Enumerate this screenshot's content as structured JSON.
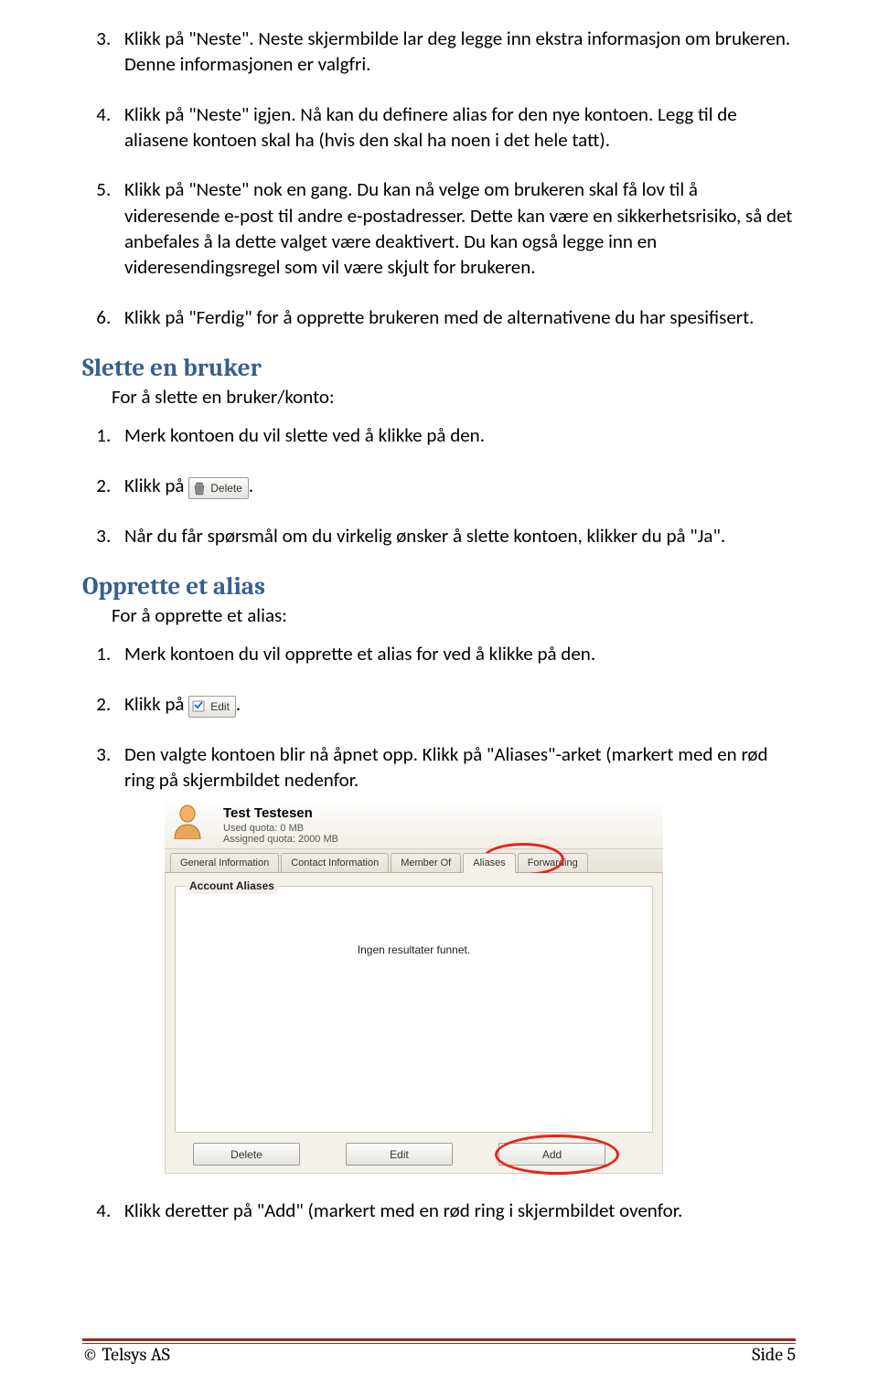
{
  "steps_continue_a": [
    "Klikk på \"Neste\". Neste skjermbilde lar deg legge inn ekstra informasjon om brukeren. Denne informasjonen er valgfri.",
    "Klikk på \"Neste\" igjen. Nå kan du definere alias for den nye kontoen. Legg til de aliasene kontoen skal ha (hvis den skal ha noen i det hele tatt).",
    "Klikk på \"Neste\" nok en gang. Du kan nå velge om brukeren skal få lov til å videresende e-post til andre e-postadresser. Dette kan være en sikkerhetsrisiko, så det anbefales å la dette valget være deaktivert. Du kan også legge inn en videresendingsregel som vil være skjult for brukeren.",
    "Klikk på \"Ferdig\" for å opprette brukeren med de alternativene du har spesifisert."
  ],
  "section_delete": {
    "heading": "Slette en bruker",
    "lead": "For å slette en bruker/konto:",
    "items": {
      "i1": "Merk kontoen du vil slette ved å klikke på den.",
      "i2_pre": "Klikk på ",
      "i2_btn_label": "Delete",
      "i2_post": ".",
      "i3": "Når du får spørsmål om du virkelig ønsker å slette kontoen, klikker du på \"Ja\"."
    }
  },
  "section_alias": {
    "heading": "Opprette et alias",
    "lead": "For å opprette et alias:",
    "items": {
      "i1": "Merk kontoen du vil opprette et alias for ved å klikke på den.",
      "i2_pre": "Klikk på ",
      "i2_btn_label": "Edit",
      "i2_post": ".",
      "i3": "Den valgte kontoen blir nå åpnet opp. Klikk på \"Aliases\"-arket (markert med en rød ring på skjermbildet nedenfor.",
      "i4": "Klikk deretter på \"Add\" (markert med en rød ring i skjermbildet ovenfor."
    }
  },
  "shot": {
    "name": "Test Testesen",
    "used_label": "Used quota:",
    "used_value": "0 MB",
    "assigned_label": "Assigned quota:",
    "assigned_value": "2000 MB",
    "tabs": [
      "General Information",
      "Contact Information",
      "Member Of",
      "Aliases",
      "Forwarding"
    ],
    "legend": "Account Aliases",
    "no_results": "Ingen resultater funnet.",
    "buttons": {
      "delete": "Delete",
      "edit": "Edit",
      "add": "Add"
    }
  },
  "footer": {
    "left": "© Telsys AS",
    "right": "Side 5"
  }
}
